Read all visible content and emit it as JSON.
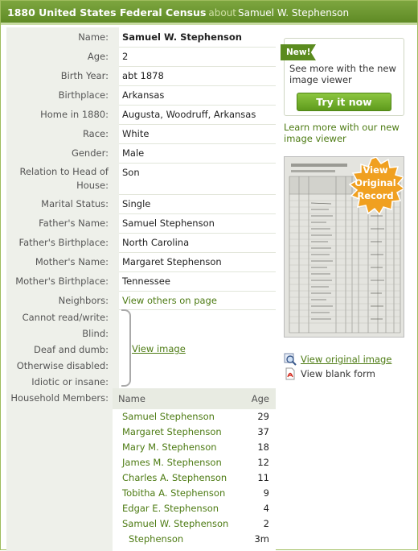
{
  "title": {
    "main": "1880 United States Federal Census",
    "about": "about",
    "person": "Samuel W. Stephenson"
  },
  "fields": [
    {
      "label": "Name:",
      "value": "Samuel W. Stephenson"
    },
    {
      "label": "Age:",
      "value": "2"
    },
    {
      "label": "Birth Year:",
      "value": "abt 1878"
    },
    {
      "label": "Birthplace:",
      "value": "Arkansas"
    },
    {
      "label": "Home in 1880:",
      "value": "Augusta, Woodruff, Arkansas"
    },
    {
      "label": "Race:",
      "value": "White"
    },
    {
      "label": "Gender:",
      "value": "Male"
    },
    {
      "label": "Relation to Head of House:",
      "value": "Son"
    },
    {
      "label": "Marital Status:",
      "value": "Single"
    },
    {
      "label": "Father's Name:",
      "value": "Samuel Stephenson"
    },
    {
      "label": "Father's Birthplace:",
      "value": "North Carolina"
    },
    {
      "label": "Mother's Name:",
      "value": "Margaret Stephenson"
    },
    {
      "label": "Mother's Birthplace:",
      "value": "Tennessee"
    },
    {
      "label": "Neighbors:",
      "value": "View others on page"
    }
  ],
  "disabilities": {
    "labels": [
      "Cannot read/write:",
      "Blind:",
      "Deaf and dumb:",
      "Otherwise disabled:",
      "Idiotic or insane:"
    ],
    "link": "View image"
  },
  "household": {
    "label": "Household Members:",
    "col_name": "Name",
    "col_age": "Age",
    "members": [
      {
        "name": "Samuel Stephenson",
        "age": "29"
      },
      {
        "name": "Margaret Stephenson",
        "age": "37"
      },
      {
        "name": "Mary M. Stephenson",
        "age": "18"
      },
      {
        "name": "James M. Stephenson",
        "age": "12"
      },
      {
        "name": "Charles A. Stephenson",
        "age": "11"
      },
      {
        "name": "Tobitha A. Stephenson",
        "age": "9"
      },
      {
        "name": "Edgar E. Stephenson",
        "age": "4"
      },
      {
        "name": "Samuel W. Stephenson",
        "age": "2"
      },
      {
        "name": "Stephenson",
        "age": "3m"
      }
    ]
  },
  "sidebar": {
    "new_badge": "New!",
    "promo_text": "See more with the new image viewer",
    "try_button": "Try it now",
    "learn_more": "Learn more with our new image viewer",
    "seal_line1": "View",
    "seal_line2": "Original",
    "seal_line3": "Record",
    "view_original": "View original image",
    "view_blank": "View blank form"
  },
  "colors": {
    "brand_green": "#5f8a25",
    "link_green": "#4d7b13",
    "seal_orange": "#f0a020"
  }
}
